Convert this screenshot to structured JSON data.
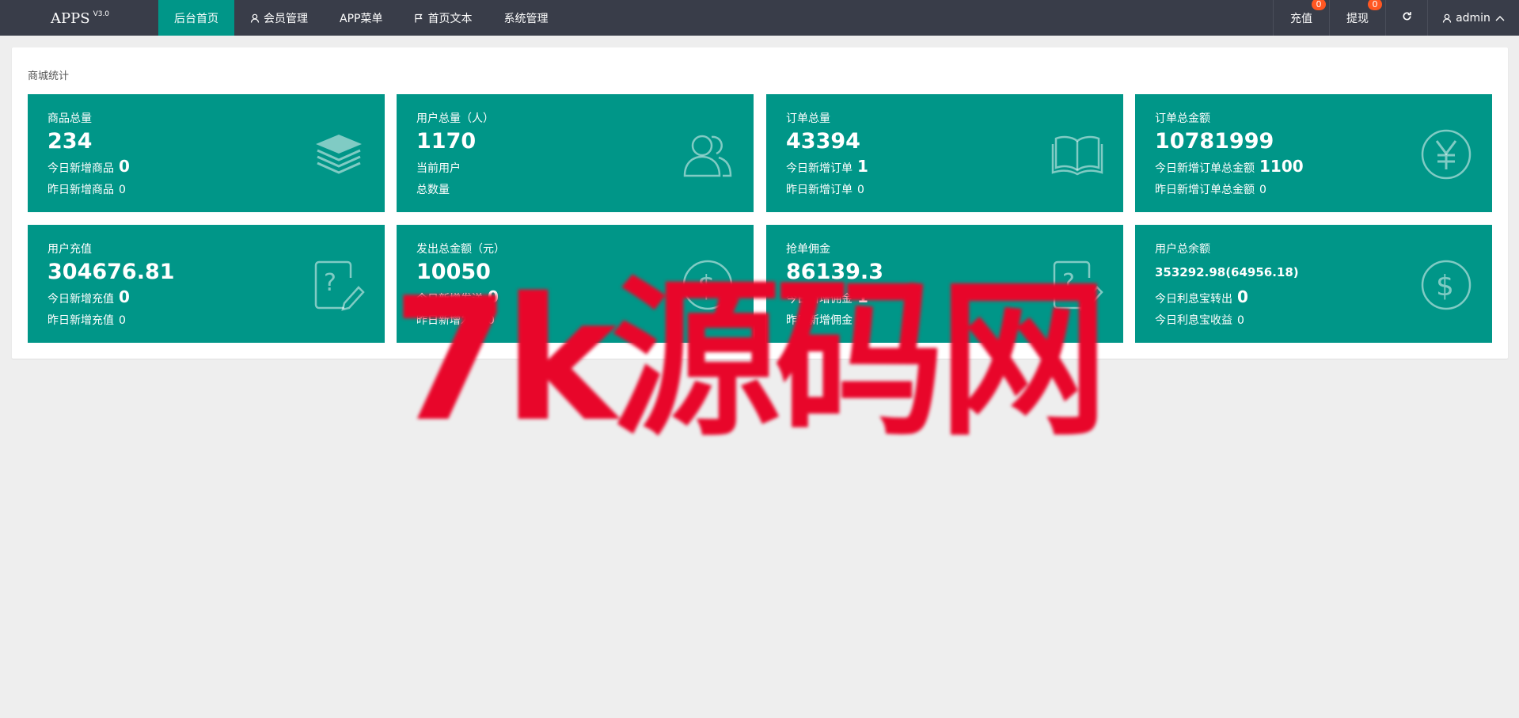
{
  "header": {
    "logo": "APPS",
    "version": "V3.0",
    "nav": [
      {
        "label": "后台首页",
        "icon": null
      },
      {
        "label": "会员管理",
        "icon": "user-icon"
      },
      {
        "label": "APP菜单",
        "icon": null
      },
      {
        "label": "首页文本",
        "icon": "flag-icon"
      },
      {
        "label": "系统管理",
        "icon": null
      }
    ],
    "active_nav_index": 0,
    "recharge_label": "充值",
    "recharge_badge": "0",
    "withdraw_label": "提现",
    "withdraw_badge": "0",
    "refresh_icon": "refresh-icon",
    "user_label": "admin",
    "user_icon": "user-icon",
    "user_chevron": "chevron-up-icon"
  },
  "panel": {
    "title": "商城统计"
  },
  "colors": {
    "header_bg": "#393d49",
    "accent": "#009688",
    "badge": "#ff5722",
    "page_bg": "#eeeeee",
    "watermark": "#e8062a"
  },
  "cards": [
    {
      "label": "商品总量",
      "value": "234",
      "line1_label": "今日新增商品",
      "line1_value": "0",
      "line2_label": "昨日新增商品",
      "line2_value": "0",
      "icon": "layers-icon"
    },
    {
      "label": "用户总量（人）",
      "value": "1170",
      "line1_label": "当前用户",
      "line1_value": "",
      "line2_label": "总数量",
      "line2_value": "",
      "icon": "users-icon"
    },
    {
      "label": "订单总量",
      "value": "43394",
      "line1_label": "今日新增订单",
      "line1_value": "1",
      "line2_label": "昨日新增订单",
      "line2_value": "0",
      "icon": "book-icon"
    },
    {
      "label": "订单总金额",
      "value": "10781999",
      "line1_label": "今日新增订单总金额",
      "line1_value": "1100",
      "line2_label": "昨日新增订单总金额",
      "line2_value": "0",
      "icon": "yen-icon"
    },
    {
      "label": "用户充值",
      "value": "304676.81",
      "line1_label": "今日新增充值",
      "line1_value": "0",
      "line2_label": "昨日新增充值",
      "line2_value": "0",
      "icon": "edit-question-icon"
    },
    {
      "label": "发出总金额（元）",
      "value": "10050",
      "line1_label": "今日新增发送",
      "line1_value": "0",
      "line2_label": "昨日新增发送",
      "line2_value": "0",
      "icon": "dollar-icon"
    },
    {
      "label": "抢单佣金",
      "value": "86139.3",
      "line1_label": "今日新增佣金",
      "line1_value": "1",
      "line2_label": "昨日新增佣金",
      "line2_value": "0",
      "icon": "edit-question-icon"
    },
    {
      "label": "用户总余额",
      "value": "353292.98(64956.18)",
      "line1_label": "今日利息宝转出",
      "line1_value": "0",
      "line2_label": "今日利息宝收益",
      "line2_value": "0",
      "icon": "dollar-icon"
    }
  ],
  "watermark": "7k源码网"
}
